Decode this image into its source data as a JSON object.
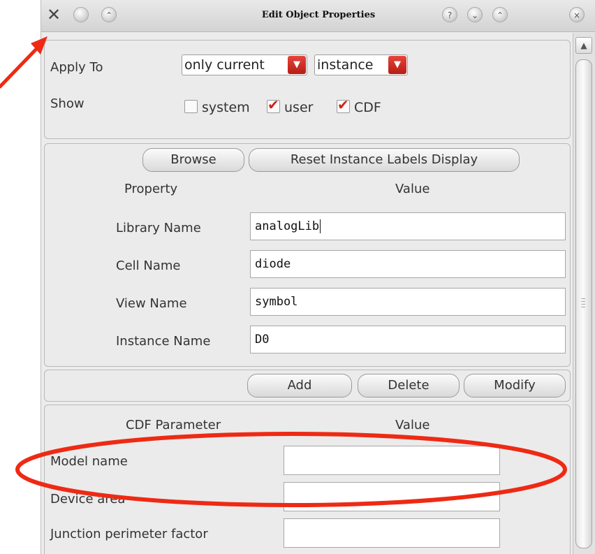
{
  "window": {
    "title": "Edit Object Properties",
    "icons": {
      "app": "tools-icon",
      "minimize": "minimize-icon",
      "shade": "shade-icon",
      "help": "help-icon",
      "down": "chevron-down-icon",
      "up": "chevron-up-icon",
      "close": "close-icon"
    },
    "help_glyph": "?",
    "close_glyph": "×"
  },
  "apply": {
    "label": "Apply To",
    "scope": "only current",
    "target": "instance"
  },
  "show": {
    "label": "Show",
    "options": [
      {
        "label": "system",
        "checked": false
      },
      {
        "label": "user",
        "checked": true
      },
      {
        "label": "CDF",
        "checked": true
      }
    ]
  },
  "toolbar": {
    "browse": "Browse",
    "reset": "Reset Instance Labels Display"
  },
  "properties": {
    "header_property": "Property",
    "header_value": "Value",
    "rows": [
      {
        "label": "Library Name",
        "value": "analogLib"
      },
      {
        "label": "Cell Name",
        "value": "diode"
      },
      {
        "label": "View Name",
        "value": "symbol"
      },
      {
        "label": "Instance Name",
        "value": "D0"
      }
    ]
  },
  "actions": {
    "add": "Add",
    "delete": "Delete",
    "modify": "Modify"
  },
  "cdf": {
    "header_param": "CDF Parameter",
    "header_value": "Value",
    "rows": [
      {
        "label": "Model name",
        "value": ""
      },
      {
        "label": "Device area",
        "value": ""
      },
      {
        "label": "Junction perimeter factor",
        "value": ""
      }
    ]
  },
  "colors": {
    "annotation": "#ee2a14",
    "combo_arrow": "#c9261d",
    "check": "#cc2418"
  }
}
